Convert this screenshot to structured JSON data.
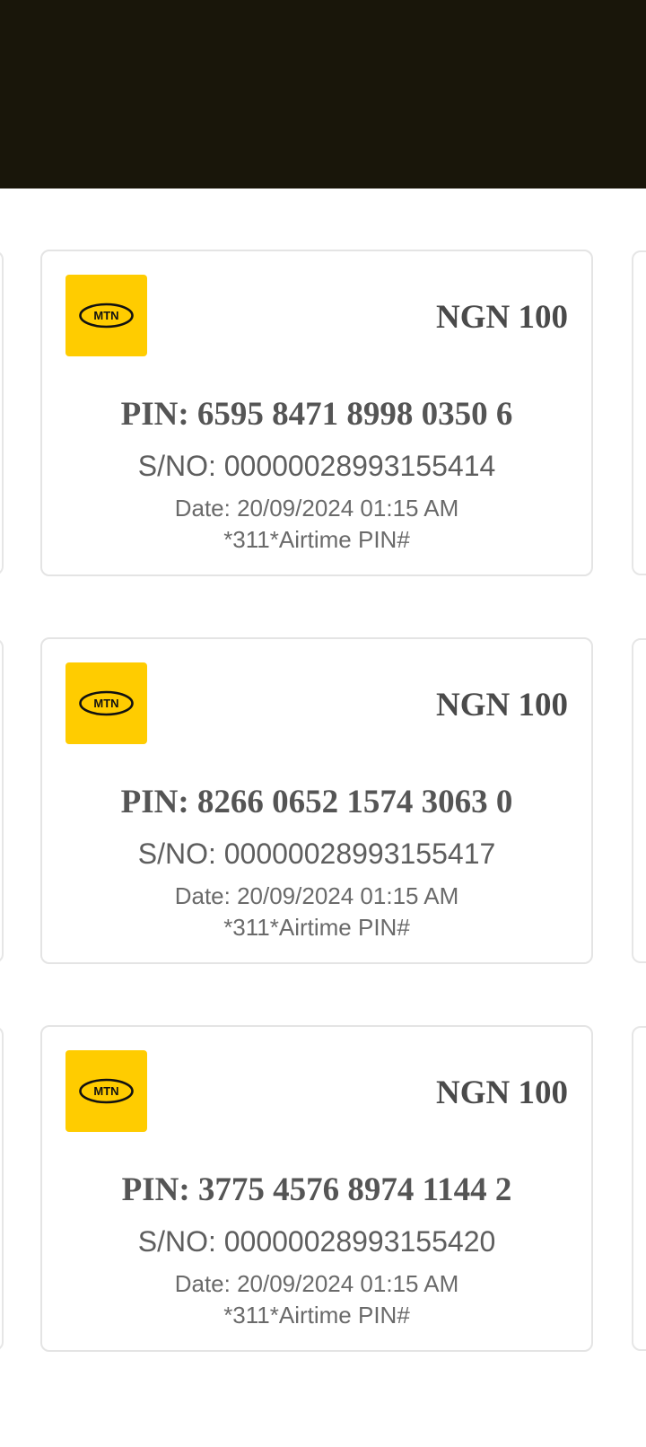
{
  "brand": {
    "logo_text": "MTN",
    "logo_bg": "#ffcc00",
    "header_color": "#19160a"
  },
  "cards": [
    {
      "amount": "NGN 100",
      "pin": "PIN: 6595 8471 8998 0350 6",
      "serial": "S/NO: 00000028993155414",
      "date": "Date: 20/09/2024 01:15 AM",
      "usage": "*311*Airtime PIN#"
    },
    {
      "amount": "NGN 100",
      "pin": "PIN: 8266 0652 1574 3063 0",
      "serial": "S/NO: 00000028993155417",
      "date": "Date: 20/09/2024 01:15 AM",
      "usage": "*311*Airtime PIN#"
    },
    {
      "amount": "NGN 100",
      "pin": "PIN: 3775 4576 8974 1144 2",
      "serial": "S/NO: 00000028993155420",
      "date": "Date: 20/09/2024 01:15 AM",
      "usage": "*311*Airtime PIN#"
    }
  ]
}
